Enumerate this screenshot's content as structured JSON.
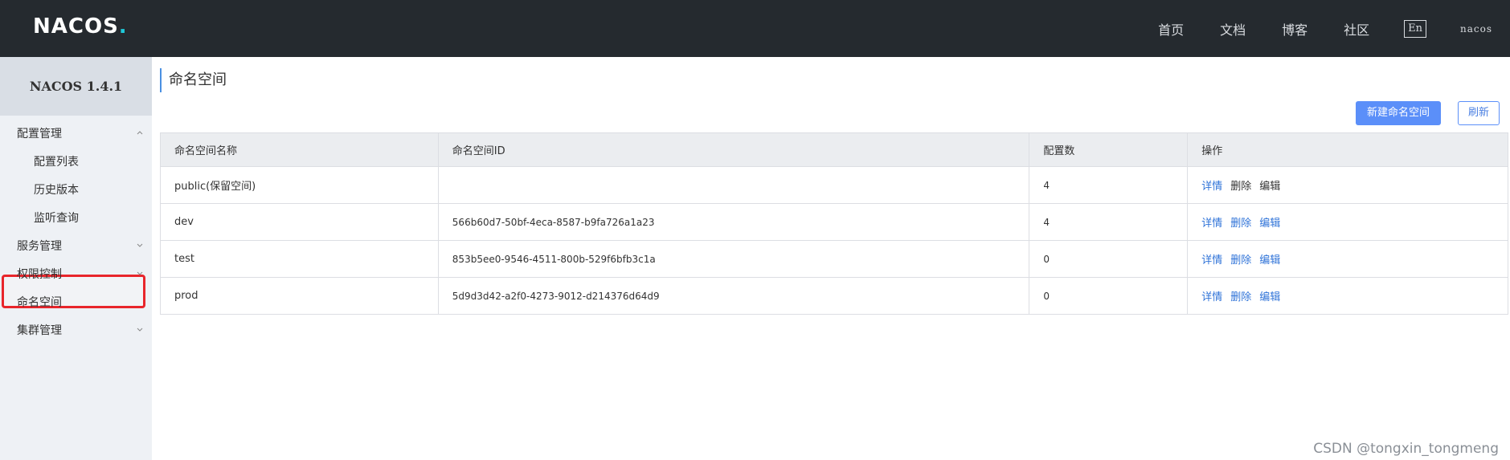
{
  "header": {
    "logo_main": "NACOS",
    "logo_dot": ".",
    "nav": [
      "首页",
      "文档",
      "博客",
      "社区"
    ],
    "lang": "En",
    "user": "nacos"
  },
  "sidebar": {
    "version": "NACOS 1.4.1",
    "items": [
      {
        "label": "配置管理",
        "type": "group",
        "expanded": true
      },
      {
        "label": "配置列表",
        "type": "sub"
      },
      {
        "label": "历史版本",
        "type": "sub"
      },
      {
        "label": "监听查询",
        "type": "sub"
      },
      {
        "label": "服务管理",
        "type": "group",
        "expanded": false
      },
      {
        "label": "权限控制",
        "type": "group",
        "expanded": false
      },
      {
        "label": "命名空间",
        "type": "item",
        "active": true
      },
      {
        "label": "集群管理",
        "type": "group",
        "expanded": false
      }
    ]
  },
  "main": {
    "title": "命名空间",
    "new_button": "新建命名空间",
    "refresh_button": "刷新",
    "table": {
      "columns": [
        "命名空间名称",
        "命名空间ID",
        "配置数",
        "操作"
      ],
      "rows": [
        {
          "name": "public(保留空间)",
          "id": "",
          "count": "4"
        },
        {
          "name": "dev",
          "id": "566b60d7-50bf-4eca-8587-b9fa726a1a23",
          "count": "4"
        },
        {
          "name": "test",
          "id": "853b5ee0-9546-4511-800b-529f6bfb3c1a",
          "count": "0"
        },
        {
          "name": "prod",
          "id": "5d9d3d42-a2f0-4273-9012-d214376d64d9",
          "count": "0"
        }
      ],
      "ops": {
        "detail": "详情",
        "delete": "删除",
        "edit": "编辑"
      }
    }
  },
  "watermark": "CSDN @tongxin_tongmeng",
  "colors": {
    "topbar": "#252a2f",
    "sidebar": "#eef1f5",
    "primary": "#5b8ff9",
    "link": "#2f73d8",
    "highlight": "#e8252b"
  }
}
